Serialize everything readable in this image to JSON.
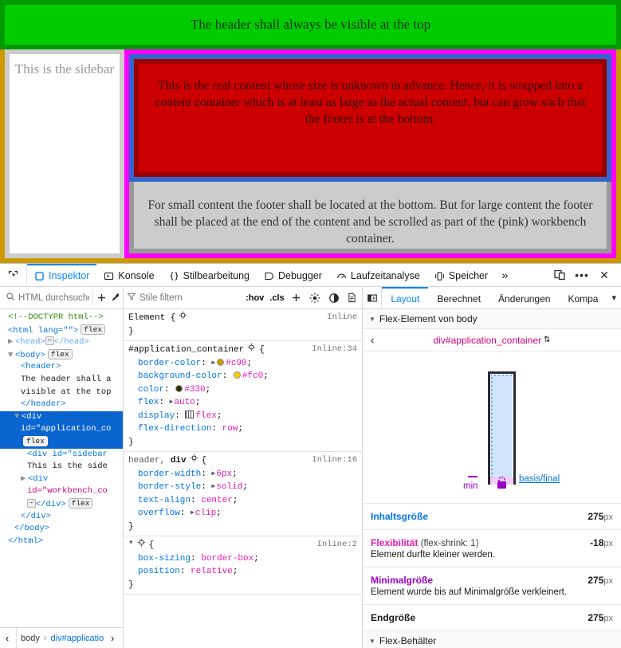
{
  "viewport": {
    "header_text": "The header shall always be visible at the top",
    "sidebar_text": "This is the sidebar",
    "content_text": "This is the real content whose size is unknown in advance. Hence, it is wrapped into a content container which is at least as large as the actual content, but can grow such that the footer is at the bottom.",
    "footer_text": "For small content the footer shall be located at the bottom. But for large content the footer shall be placed at the end of the content and be scrolled as part of the (pink) workbench container.",
    "colors": {
      "header_bg": "#00cc00",
      "header_border": "#009900",
      "application_container_bg": "#ffcc00",
      "application_container_border": "#cc9900",
      "sidebar_bg": "#ffffff",
      "sidebar_border": "#cccccc",
      "workbench_border": "#ff00ff",
      "content_container_border": "#3366cc",
      "content_bg": "#cc0000",
      "content_border": "#990000",
      "footer_bg": "#cccccc",
      "footer_border": "#999999",
      "text_color": "#333300"
    }
  },
  "devtools": {
    "picker_icon": "element-picker-icon",
    "tabs": [
      {
        "label": "Inspektor",
        "icon": "inspector-icon",
        "active": true
      },
      {
        "label": "Konsole",
        "icon": "console-icon",
        "active": false
      },
      {
        "label": "Stilbearbeitung",
        "icon": "style-editor-icon",
        "active": false
      },
      {
        "label": "Debugger",
        "icon": "debugger-icon",
        "active": false
      },
      {
        "label": "Laufzeitanalyse",
        "icon": "performance-icon",
        "active": false
      },
      {
        "label": "Speicher",
        "icon": "storage-icon",
        "active": false
      }
    ],
    "overflow_label": "»",
    "right_buttons": [
      {
        "name": "responsive-design-mode-icon",
        "label": ""
      },
      {
        "name": "meatball-menu-icon",
        "label": "•••"
      },
      {
        "name": "close-icon",
        "label": "✕"
      }
    ],
    "markup": {
      "search_placeholder": "HTML durchsuchen",
      "search_value": "",
      "add_node_label": "+",
      "eyedropper_name": "eyedropper-icon",
      "lines": [
        {
          "indent": 1,
          "type": "comment",
          "text": "<!--DOCTYPR html-->"
        },
        {
          "indent": 1,
          "type": "open",
          "text": "<html lang=\"\">",
          "badge": "flex"
        },
        {
          "indent": 1,
          "type": "collapsed",
          "twisty": "▶",
          "text": "<head>",
          "ellipsis": true,
          "close": "</head>"
        },
        {
          "indent": 1,
          "type": "open",
          "twisty": "▼",
          "text": "<body>",
          "badge": "flex"
        },
        {
          "indent": 2,
          "type": "open",
          "text": "<header>"
        },
        {
          "indent": 2,
          "type": "text",
          "text": "The header shall a"
        },
        {
          "indent": 2,
          "type": "text",
          "text": "visible at the top"
        },
        {
          "indent": 2,
          "type": "close",
          "text": "</header>"
        },
        {
          "indent": 2,
          "type": "open",
          "twisty": "▼",
          "text": "<div",
          "selected": true
        },
        {
          "indent": 2,
          "type": "attr",
          "text": "id=\"application_co",
          "selected": true
        },
        {
          "indent": 2,
          "type": "badgeonly",
          "badge": "flex",
          "selected": true
        },
        {
          "indent": 3,
          "type": "open",
          "text": "<div id=\"sidebar"
        },
        {
          "indent": 3,
          "type": "text",
          "text": "This is the side"
        },
        {
          "indent": 3,
          "type": "open",
          "twisty": "▶",
          "text": "<div"
        },
        {
          "indent": 3,
          "type": "attr",
          "text": "id=\"workbench_co"
        },
        {
          "indent": 3,
          "type": "closeflex",
          "ellipsis": true,
          "text": "</div>",
          "badge": "flex"
        },
        {
          "indent": 2,
          "type": "close",
          "text": "</div>"
        },
        {
          "indent": 1,
          "type": "close",
          "text": "</body>"
        },
        {
          "indent": 0,
          "type": "close",
          "text": "</html>"
        }
      ],
      "breadcrumb": {
        "left_arrow": "‹",
        "right_arrow": "›",
        "items": [
          "body",
          "div#applicatio"
        ]
      }
    },
    "rules": {
      "filter_placeholder": "Stile filtern",
      "filter_value": "",
      "hov_label": ":hov",
      "cls_label": ".cls",
      "add_rule_label": "+",
      "toolbar_icons": [
        "light-mode-icon",
        "dark-mode-icon",
        "print-media-icon"
      ],
      "entries": [
        {
          "selector": "Element {",
          "origin": "Inline",
          "declarations": [],
          "closing": "}"
        },
        {
          "selector": "#application_container",
          "has_tool_icon": true,
          "brace": "{",
          "origin": "Inline:34",
          "declarations": [
            {
              "prop": "border-color",
              "value": "#c90",
              "swatch": "#cc9900",
              "expander": true
            },
            {
              "prop": "background-color",
              "value": "#fc0",
              "swatch": "#ffcc00"
            },
            {
              "prop": "color",
              "value": "#330",
              "swatch": "#333300"
            },
            {
              "prop": "flex",
              "value": "auto",
              "expander": true,
              "keyword": true
            },
            {
              "prop": "display",
              "value": "flex",
              "flexmark": true,
              "keyword": true
            },
            {
              "prop": "flex-direction",
              "value": "row",
              "keyword": true
            }
          ],
          "closing": "}"
        },
        {
          "selector_match": "header, div",
          "has_tool_icon": true,
          "brace": "{",
          "origin": "Inline:16",
          "declarations": [
            {
              "prop": "border-width",
              "value": "6px",
              "expander": true,
              "keyword": true
            },
            {
              "prop": "border-style",
              "value": "solid",
              "expander": true,
              "keyword": true
            },
            {
              "prop": "text-align",
              "value": "center",
              "keyword": true
            },
            {
              "prop": "overflow",
              "value": "clip",
              "expander": true,
              "keyword": true
            }
          ],
          "closing": "}"
        },
        {
          "selector_match": "*",
          "has_tool_icon": true,
          "brace": "{",
          "origin": "Inline:2",
          "declarations": [
            {
              "prop": "box-sizing",
              "value": "border-box",
              "keyword": true
            },
            {
              "prop": "position",
              "value": "relative",
              "keyword": true
            }
          ],
          "closing": "}"
        }
      ]
    },
    "layout": {
      "sidebar_toggle_name": "pane-toggle-icon",
      "tabs": [
        {
          "label": "Layout",
          "active": true
        },
        {
          "label": "Berechnet",
          "active": false
        },
        {
          "label": "Änderungen",
          "active": false
        },
        {
          "label": "Kompa",
          "active": false
        }
      ],
      "more_label": "▾",
      "flex_item_section": "Flex-Element von body",
      "flex_item_element": "div#application_container",
      "diagram": {
        "basis_label": "basis/final",
        "min_label": "min",
        "lock_icon": "lock-icon"
      },
      "rows": [
        {
          "title": "Inhaltsgröße",
          "color": "blue",
          "sub": "",
          "note": "",
          "value": "275",
          "unit": "px"
        },
        {
          "title": "Flexibilität",
          "color": "pink",
          "sub": "(flex-shrink: 1)",
          "note": "Element durfte kleiner werden.",
          "value": "-18",
          "unit": "px"
        },
        {
          "title": "Minimalgröße",
          "color": "purple",
          "sub": "",
          "note": "Element wurde bis auf Minimalgröße verkleinert.",
          "value": "275",
          "unit": "px"
        },
        {
          "title": "Endgröße",
          "color": "dark",
          "sub": "",
          "note": "",
          "value": "275",
          "unit": "px"
        }
      ],
      "flex_container_section": "Flex-Behälter"
    }
  }
}
